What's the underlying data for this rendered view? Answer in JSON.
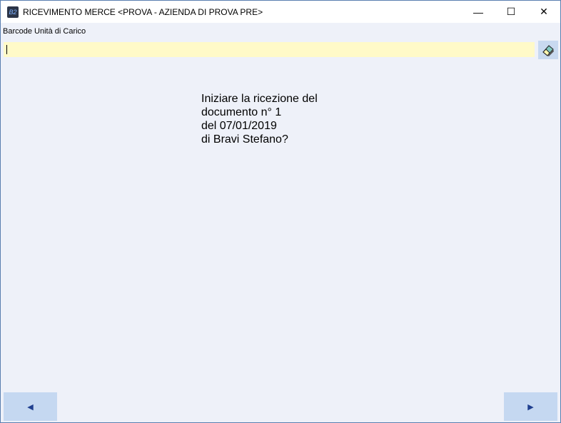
{
  "window": {
    "title": "RICEVIMENTO MERCE <PROVA - AZIENDA DI PROVA PRE>",
    "app_icon_text": "B2"
  },
  "form": {
    "barcode_label": "Barcode Unità di Carico",
    "barcode_value": ""
  },
  "message": {
    "lines": [
      "Iniziare la ricezione del",
      "documento n° 1",
      "del 07/01/2019",
      "di Bravi Stefano?"
    ]
  },
  "nav": {
    "prev": "◀",
    "next": "▶"
  },
  "controls": {
    "minimize": "—",
    "maximize": "☐",
    "close": "✕"
  }
}
